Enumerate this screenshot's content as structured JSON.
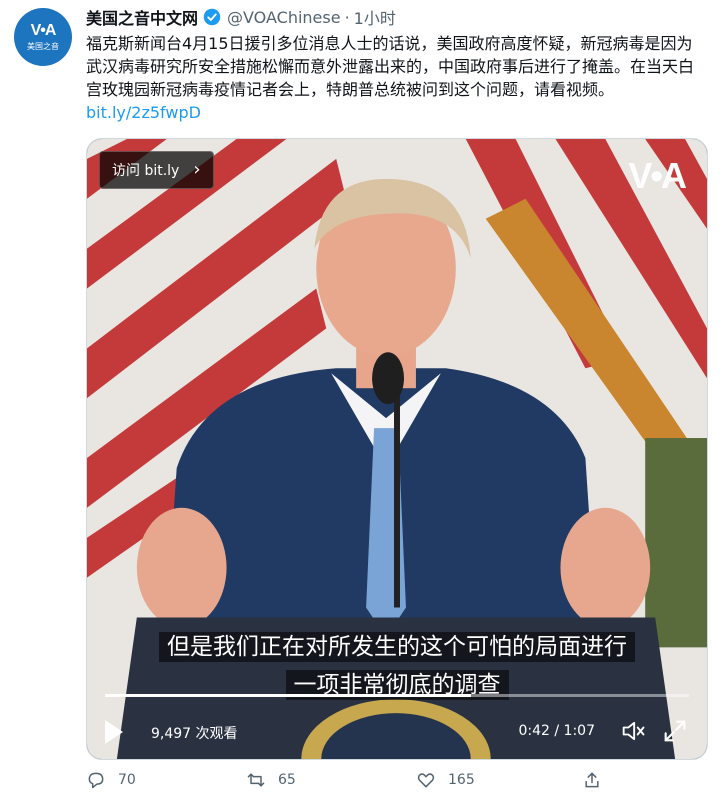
{
  "account": {
    "avatar_logo": "V•A",
    "avatar_sub": "美国之音",
    "display_name": "美国之音中文网",
    "handle": "@VOAChinese",
    "separator": "·",
    "time": "1小时"
  },
  "tweet": {
    "text": "福克斯新闻台4月15日援引多位消息人士的话说，美国政府高度怀疑，新冠病毒是因为武汉病毒研究所安全措施松懈而意外泄露出来的，中国政府事后进行了掩盖。在当天白宫玫瑰园新冠病毒疫情记者会上，特朗普总统被问到这个问题，请看视频。",
    "link": "bit.ly/2z5fwpD"
  },
  "video": {
    "visit_label": "访问 bit.ly",
    "watermark": "V•A",
    "subtitle_line1": "但是我们正在对所发生的这个可怕的局面进行",
    "subtitle_line2": "一项非常彻底的调查",
    "views": "9,497 次观看",
    "timecode": "0:42 / 1:07",
    "progress": 0.627
  },
  "actions": {
    "replies": "70",
    "retweets": "65",
    "likes": "165"
  },
  "colors": {
    "link": "#1d9bf0",
    "avatar_bg": "#1d74bf",
    "muted": "#536471"
  }
}
